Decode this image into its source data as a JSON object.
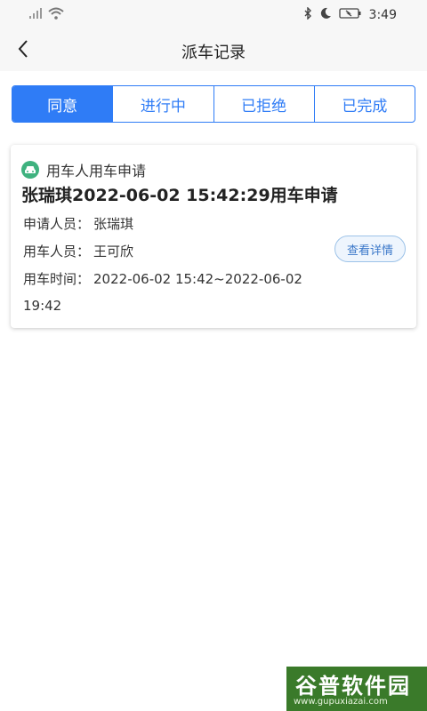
{
  "status_bar": {
    "time": "3:49"
  },
  "header": {
    "title": "派车记录"
  },
  "tabs": [
    {
      "label": "同意",
      "active": true
    },
    {
      "label": "进行中",
      "active": false
    },
    {
      "label": "已拒绝",
      "active": false
    },
    {
      "label": "已完成",
      "active": false
    }
  ],
  "record": {
    "type_label": "用车人用车申请",
    "title": "张瑞琪2022-06-02 15:42:29用车申请",
    "applicant_label": "申请人员：",
    "applicant_value": "张瑞琪",
    "user_label": "用车人员：",
    "user_value": "王可欣",
    "time_label": "用车时间：",
    "time_value": "2022-06-02 15:42~2022-06-02",
    "time_value_cont": "19:42",
    "details_label": "查看详情"
  },
  "watermark": {
    "logo": "谷普软件园",
    "url": "www.gupuxiazai.com"
  },
  "colors": {
    "accent": "#2f7cf6",
    "car_icon": "#3fb27f",
    "details_text": "#3b78c9"
  }
}
